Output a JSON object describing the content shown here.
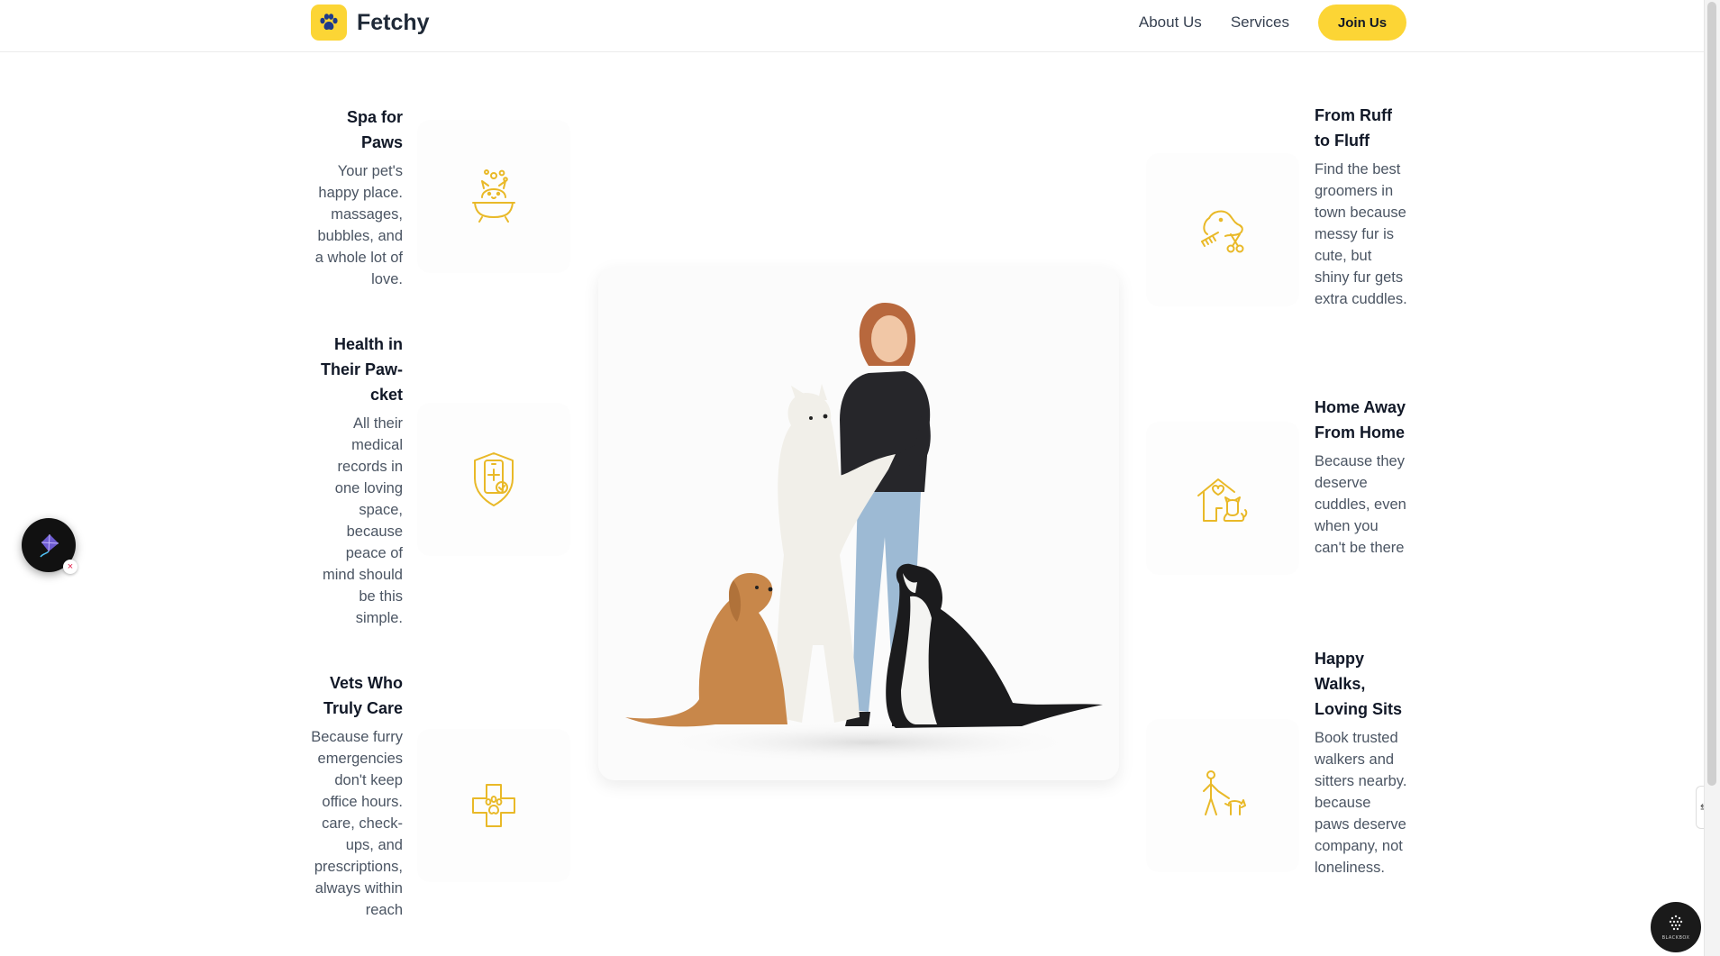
{
  "brand": {
    "name": "Fetchy",
    "logo_icon": "paw-icon",
    "accent": "#fcd535"
  },
  "nav": {
    "about": "About Us",
    "services": "Services",
    "join": "Join Us"
  },
  "features_left": [
    {
      "title": "Spa for Paws",
      "text": "Your pet's happy place. massages, bubbles, and a whole lot of love.",
      "icon": "pet-bath-icon"
    },
    {
      "title": "Health in Their Paw-cket",
      "text": "All their medical records in one loving space, because peace of mind should be this simple.",
      "icon": "phone-health-shield-icon"
    },
    {
      "title": "Vets Who Truly Care",
      "text": "Because furry emergencies don't keep office hours. care, check-ups, and prescriptions, always within reach",
      "icon": "medical-cross-paw-icon"
    }
  ],
  "features_right": [
    {
      "title": "From Ruff to Fluff",
      "text": "Find the best groomers in town because messy fur is cute, but shiny fur gets extra cuddles.",
      "icon": "dog-grooming-icon"
    },
    {
      "title": "Home Away From Home",
      "text": "Because they deserve cuddles, even when you can't be there",
      "icon": "pet-house-icon"
    },
    {
      "title": "Happy Walks, Loving Sits",
      "text": "Book trusted walkers and sitters nearby. because paws deserve company, not loneliness.",
      "icon": "dog-walker-icon"
    }
  ],
  "hero": {
    "image": "woman-with-three-dogs-photo"
  },
  "widgets": {
    "badge_text": "BLACKBOX",
    "fab_close": "×",
    "side_tab": "⇆"
  }
}
